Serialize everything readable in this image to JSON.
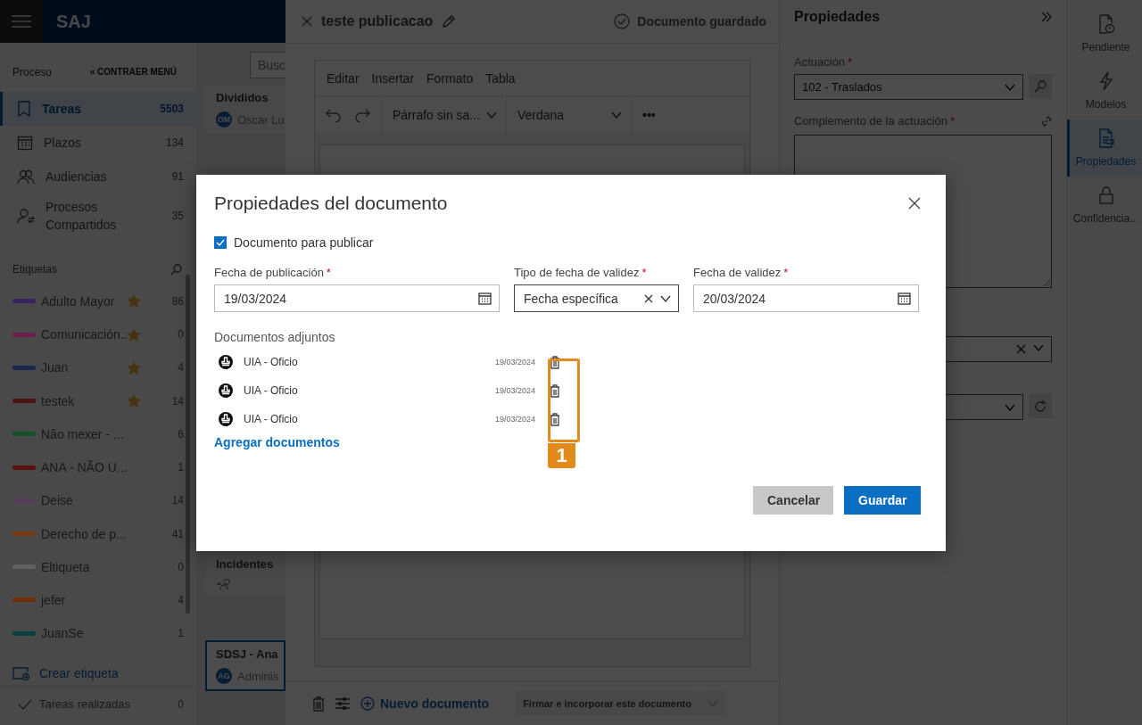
{
  "app_bar": {
    "logo": "SAJ"
  },
  "sidebar": {
    "section": "Proceso",
    "collapse_link": "« CONTRAER MENÚ",
    "items": [
      {
        "label": "Tareas",
        "count": "5503",
        "selected": true
      },
      {
        "label": "Plazos",
        "count": "134",
        "selected": false
      },
      {
        "label": "Audiencias",
        "count": "91",
        "selected": false
      },
      {
        "label": "Procesos Compartidos",
        "count": "35",
        "selected": false
      }
    ],
    "tags_title": "Etiquetas",
    "tags": [
      {
        "name": "Adulto Mayor",
        "color": "#3a2460",
        "starred": true,
        "count": "86"
      },
      {
        "name": "Comunicación..",
        "color": "#6a1f4c",
        "starred": true,
        "count": "0"
      },
      {
        "name": "Juan",
        "color": "#17284a",
        "starred": true,
        "count": "4"
      },
      {
        "name": "testek",
        "color": "#4a1414",
        "starred": true,
        "count": "14"
      },
      {
        "name": "Não mexer - ...",
        "color": "#145028",
        "starred": false,
        "count": "6"
      },
      {
        "name": "ANA - NÃO U...",
        "color": "#5a1010",
        "starred": false,
        "count": "1"
      },
      {
        "name": "Deise",
        "color": "#5a3a5c",
        "starred": false,
        "count": "14"
      },
      {
        "name": "Derecho de p...",
        "color": "#7a3a10",
        "starred": false,
        "count": "41"
      },
      {
        "name": "Eltiqueta",
        "color": "#606060",
        "starred": false,
        "count": "0"
      },
      {
        "name": "jefer",
        "color": "#702e08",
        "starred": false,
        "count": "4"
      },
      {
        "name": "JuanSe",
        "color": "#0a4040",
        "starred": false,
        "count": "1"
      }
    ],
    "create_tag": "Crear etiqueta",
    "done": {
      "label": "Tareas realizadas",
      "count": "0"
    }
  },
  "task_list": {
    "search": {
      "placeholder": "Busc"
    },
    "cards": [
      {
        "title": "Divididos",
        "avatar": "OM",
        "person": "Oscar Lu",
        "selected": false
      },
      {
        "title": "Incidentes",
        "selected": false
      },
      {
        "title": "SDSJ - Ana",
        "avatar": "AG",
        "person": "Adminis",
        "selected": true
      }
    ]
  },
  "editor": {
    "title": "teste publicacao",
    "status": "Documento guardado",
    "menus": [
      "Editar",
      "Insertar",
      "Formato",
      "Tabla"
    ],
    "paragraph_style": "Párrafo sin sa...",
    "font": "Verdana",
    "more": "•••",
    "new_document": "Nuevo documento",
    "sign_button": {
      "label": "Firmar e incorporar este documento",
      "disabled": true
    }
  },
  "properties": {
    "title": "Propiedades",
    "actuacion": {
      "label": "Actuación",
      "required_mark": "*",
      "value": "102 - Traslados"
    },
    "complemento": {
      "label": "Complemento de la actuación",
      "required_mark": "*"
    }
  },
  "rail": [
    {
      "label": "Pendiente",
      "selected": false
    },
    {
      "label": "Modelos",
      "selected": false
    },
    {
      "label": "Propiedades",
      "selected": true
    },
    {
      "label": "Confidencia...",
      "selected": false
    }
  ],
  "dialog": {
    "title": "Propiedades del documento",
    "publish": {
      "label": "Documento para publicar",
      "checked": true
    },
    "fields": [
      {
        "kind": "date",
        "label": "Fecha de publicación",
        "required_mark": "*",
        "value": "19/03/2024"
      },
      {
        "kind": "select",
        "label": "Tipo de fecha de validez",
        "required_mark": "*",
        "value": "Fecha específica"
      },
      {
        "kind": "date",
        "label": "Fecha de validez",
        "required_mark": "*",
        "value": "20/03/2024"
      }
    ],
    "attachments_label": "Documentos adjuntos",
    "attachments": [
      {
        "name": "UIA - Oficio",
        "date": "19/03/2024"
      },
      {
        "name": "UIA - Oficio",
        "date": "19/03/2024"
      },
      {
        "name": "UIA - Oficio",
        "date": "19/03/2024"
      }
    ],
    "add_link": "Agregar documentos",
    "buttons": [
      {
        "kind": "secondary",
        "label": "Cancelar"
      },
      {
        "kind": "primary",
        "label": "Guardar"
      }
    ],
    "callout": {
      "label": "1"
    }
  }
}
